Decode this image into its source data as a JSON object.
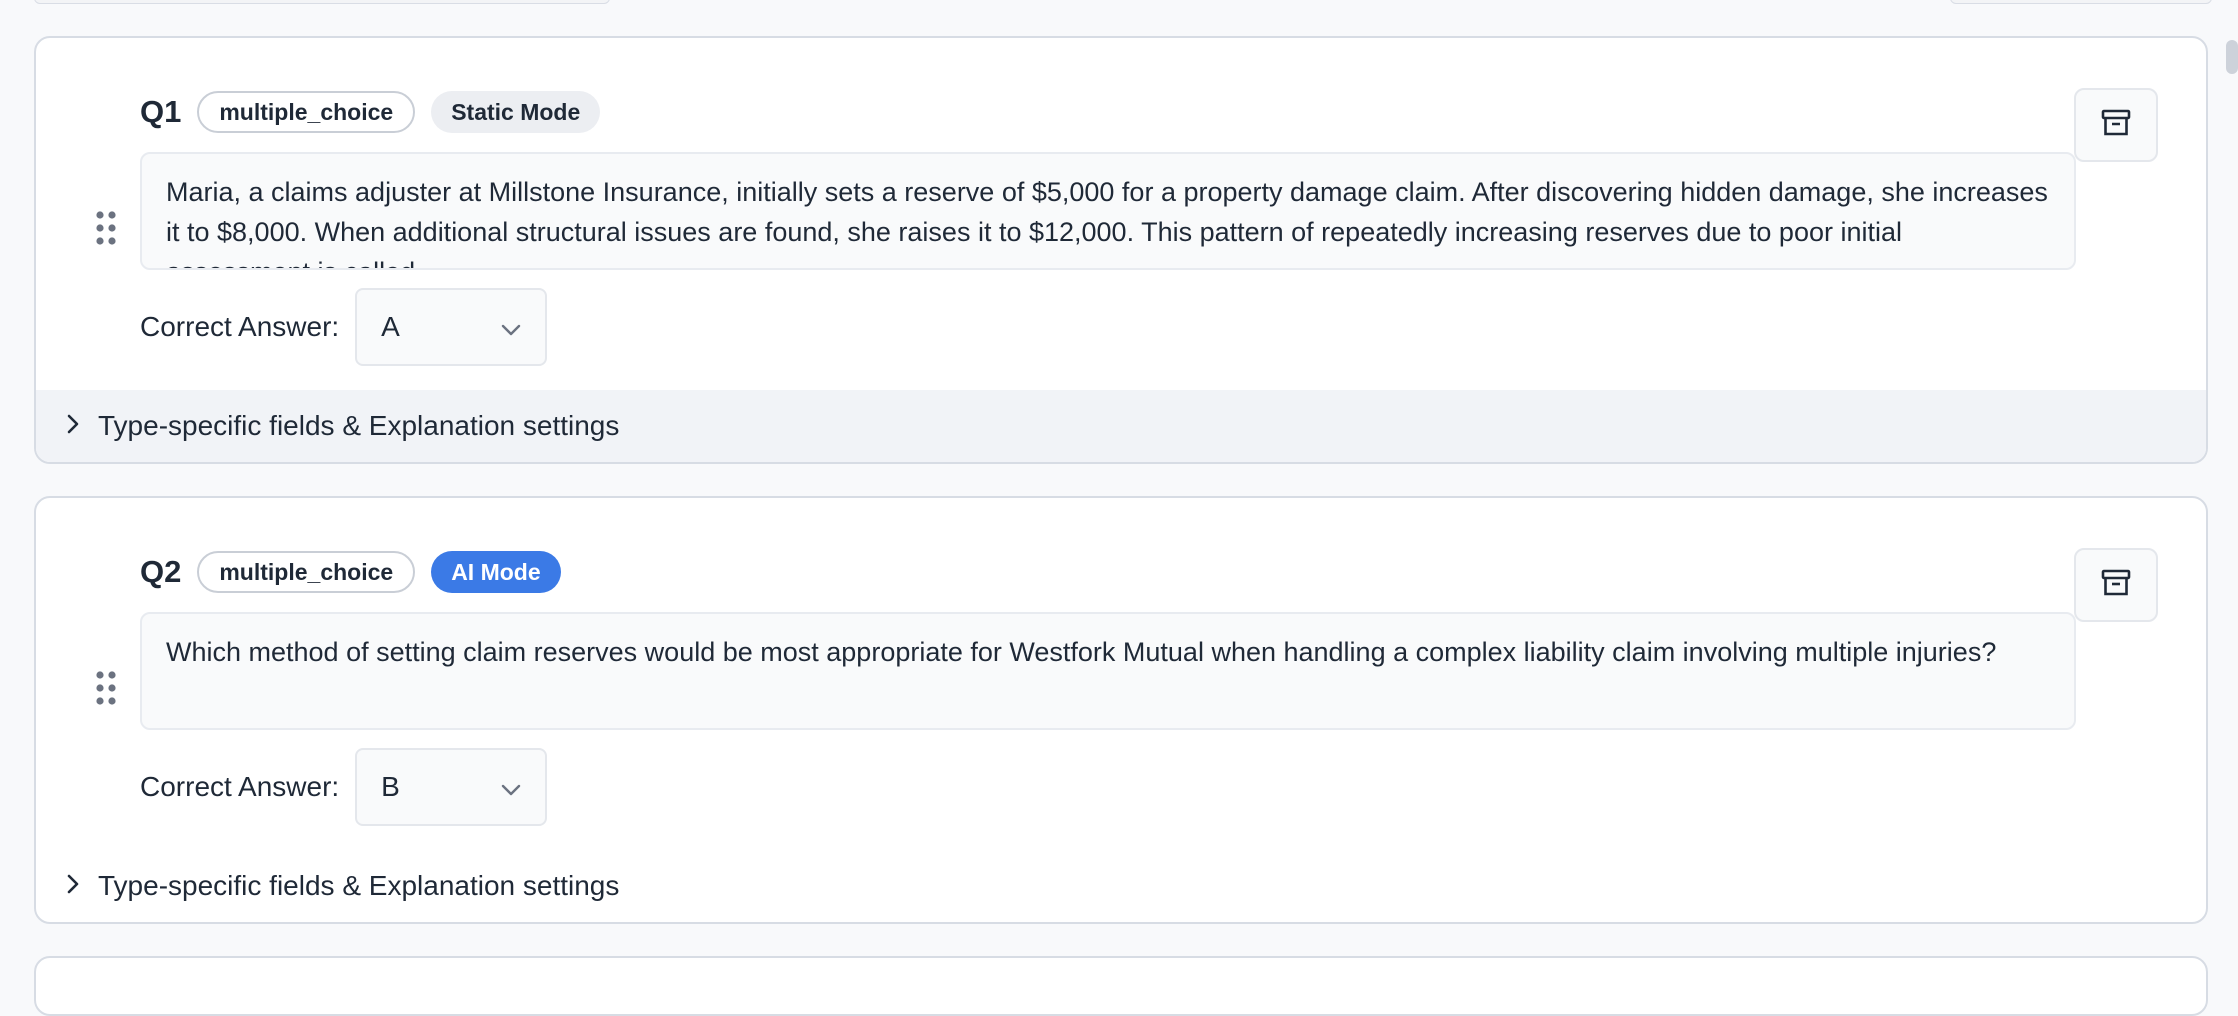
{
  "questions": [
    {
      "number": "Q1",
      "type_badge": "multiple_choice",
      "mode_badge": "Static Mode",
      "question_text": "Maria, a claims adjuster at Millstone Insurance, initially sets a reserve of $5,000 for a property damage claim. After discovering hidden damage, she increases it to $8,000. When additional structural issues are found, she raises it to $12,000. This pattern of repeatedly increasing reserves due to poor initial assessment is called",
      "correct_answer_label": "Correct Answer:",
      "correct_answer_value": "A",
      "details_label": "Type-specific fields & Explanation settings"
    },
    {
      "number": "Q2",
      "type_badge": "multiple_choice",
      "mode_badge": "AI Mode",
      "question_text": "Which method of setting claim reserves would be most appropriate for Westfork Mutual when handling a complex liability claim involving multiple injuries?",
      "correct_answer_label": "Correct Answer:",
      "correct_answer_value": "B",
      "details_label": "Type-specific fields & Explanation settings"
    }
  ],
  "colors": {
    "ai_mode_badge": "#3b7ae6",
    "static_mode_badge": "#eceef2",
    "card_border": "#d7dce4"
  },
  "icons": [
    "drag-handle-icon",
    "archive-icon",
    "chevron-down-icon",
    "chevron-right-icon"
  ]
}
